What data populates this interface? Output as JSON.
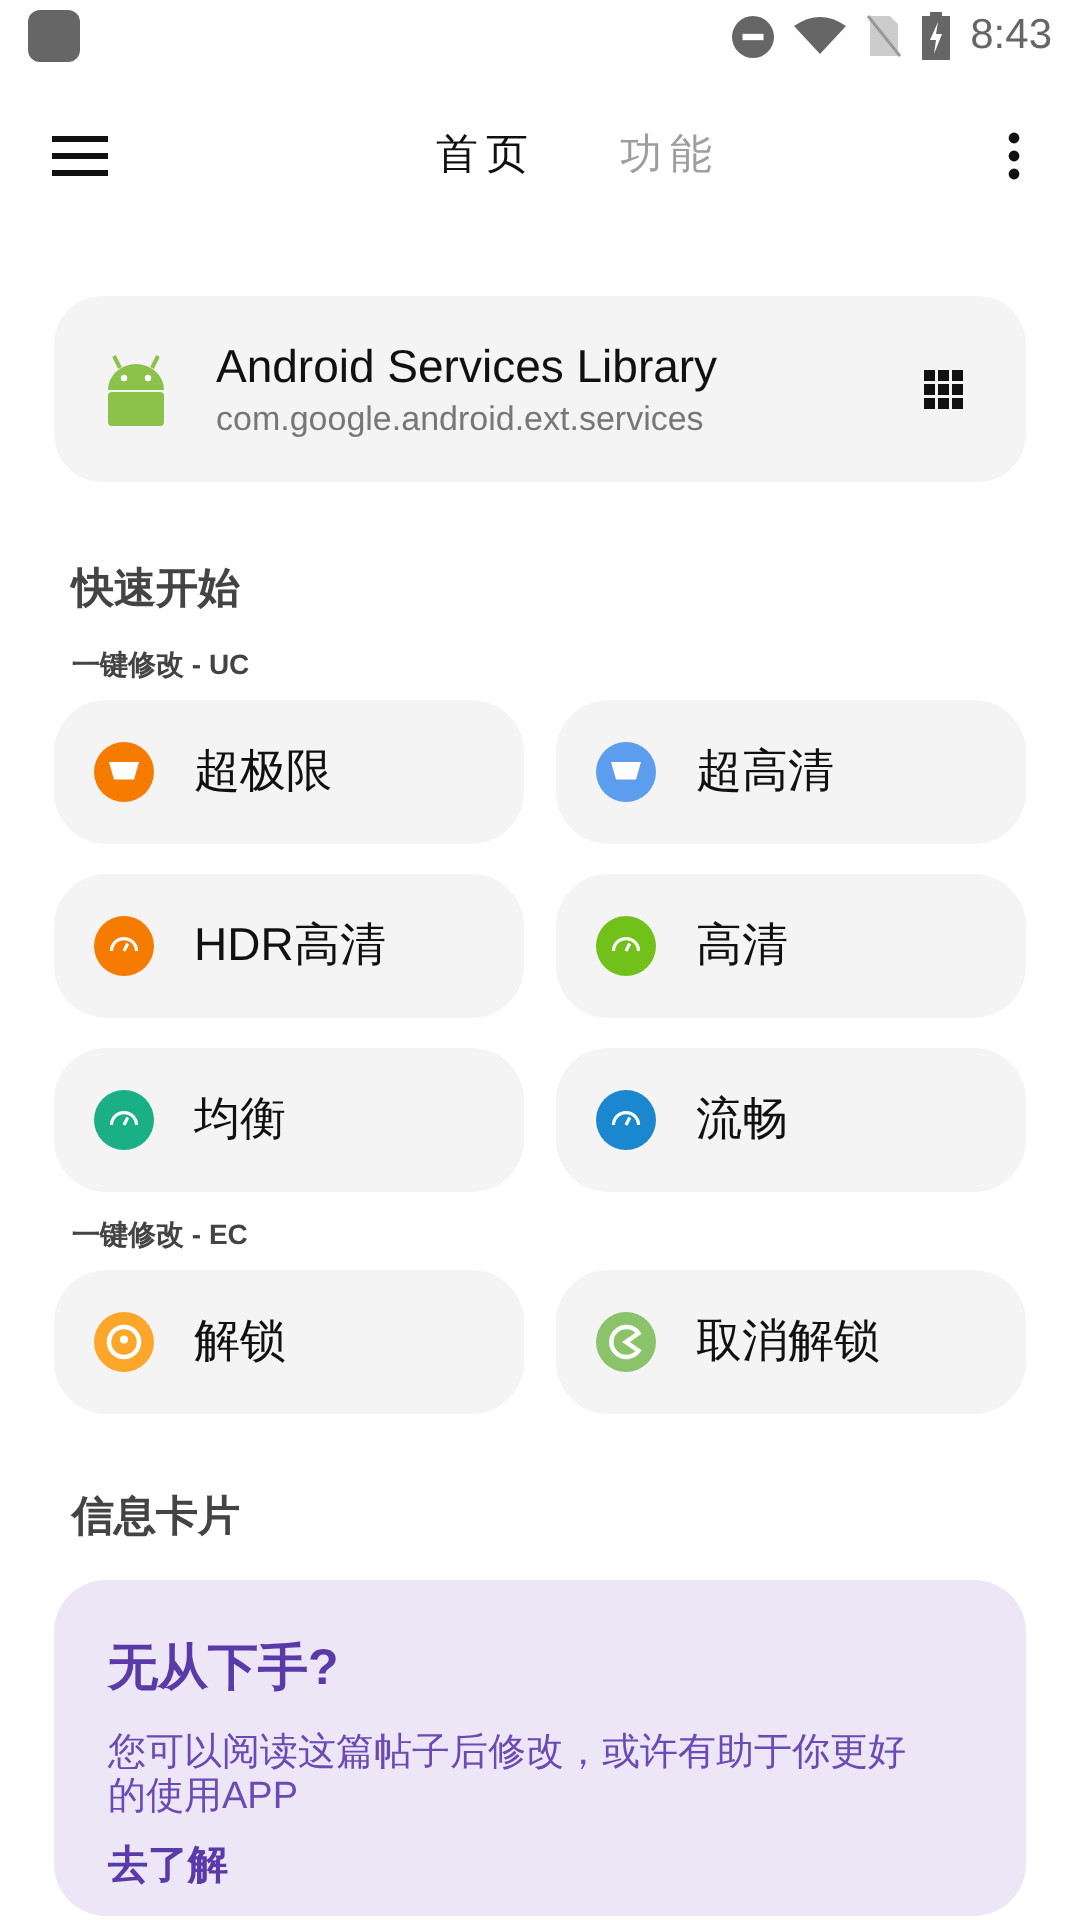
{
  "status_bar": {
    "time": "8:43"
  },
  "toolbar": {
    "tabs": [
      {
        "label": "首页",
        "selected": true
      },
      {
        "label": "功能",
        "selected": false
      }
    ]
  },
  "app_card": {
    "name": "Android Services Library",
    "package": "com.google.android.ext.services"
  },
  "quick_start": {
    "title": "快速开始",
    "groups": [
      {
        "label": "一键修改 - UC",
        "items": [
          {
            "label": "超极限",
            "kind": "screen",
            "color": "#f57c00"
          },
          {
            "label": "超高清",
            "kind": "screen",
            "color": "#5c9ded"
          },
          {
            "label": "HDR高清",
            "kind": "gauge",
            "color": "#f57c00"
          },
          {
            "label": "高清",
            "kind": "gauge",
            "color": "#72c11b"
          },
          {
            "label": "均衡",
            "kind": "gauge",
            "color": "#1aaf84"
          },
          {
            "label": "流畅",
            "kind": "gauge",
            "color": "#1a87cf"
          }
        ]
      },
      {
        "label": "一键修改 - EC",
        "items": [
          {
            "label": "解锁",
            "kind": "target",
            "color": "#fda72a"
          },
          {
            "label": "取消解锁",
            "kind": "chomp",
            "color": "#8ac36a"
          }
        ]
      }
    ]
  },
  "info": {
    "title": "信息卡片",
    "card": {
      "heading": "无从下手?",
      "body": "您可以阅读这篇帖子后修改，或许有助于你更好的使用APP",
      "link": "去了解"
    }
  }
}
